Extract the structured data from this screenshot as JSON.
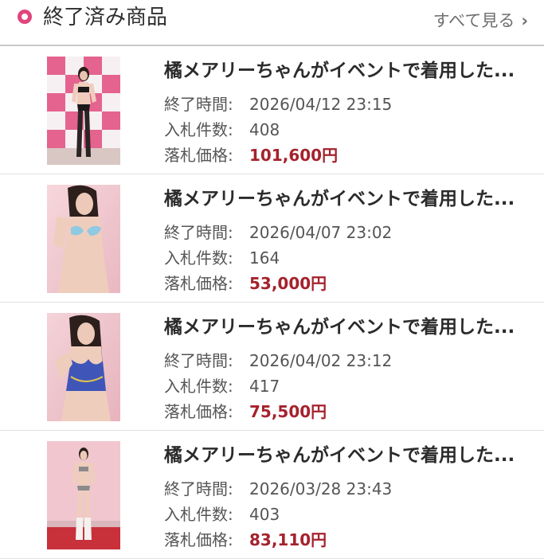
{
  "header": {
    "title": "終了済み商品",
    "see_all": "すべて見る",
    "chevron": "›"
  },
  "labels": {
    "end_time": "終了時間:",
    "bid_count": "入札件数:",
    "winning_price": "落札価格:"
  },
  "items": [
    {
      "title": "橘メアリーちゃんがイベントで着用した...",
      "end_time": "2026/04/12 23:15",
      "bid_count": "408",
      "price": "101,600円",
      "thumbnail": "photo-model-pink-backdrop"
    },
    {
      "title": "橘メアリーちゃんがイベントで着用した...",
      "end_time": "2026/04/07 23:02",
      "bid_count": "164",
      "price": "53,000円",
      "thumbnail": "photo-model-blue-bikini"
    },
    {
      "title": "橘メアリーちゃんがイベントで着用した...",
      "end_time": "2026/04/02 23:12",
      "bid_count": "417",
      "price": "75,500円",
      "thumbnail": "photo-model-blue-outfit"
    },
    {
      "title": "橘メアリーちゃんがイベントで着用した...",
      "end_time": "2026/03/28 23:43",
      "bid_count": "403",
      "price": "83,110円",
      "thumbnail": "photo-model-white-boots"
    }
  ],
  "colors": {
    "accent_pink": "#e0457b",
    "price_red": "#a5222d"
  }
}
